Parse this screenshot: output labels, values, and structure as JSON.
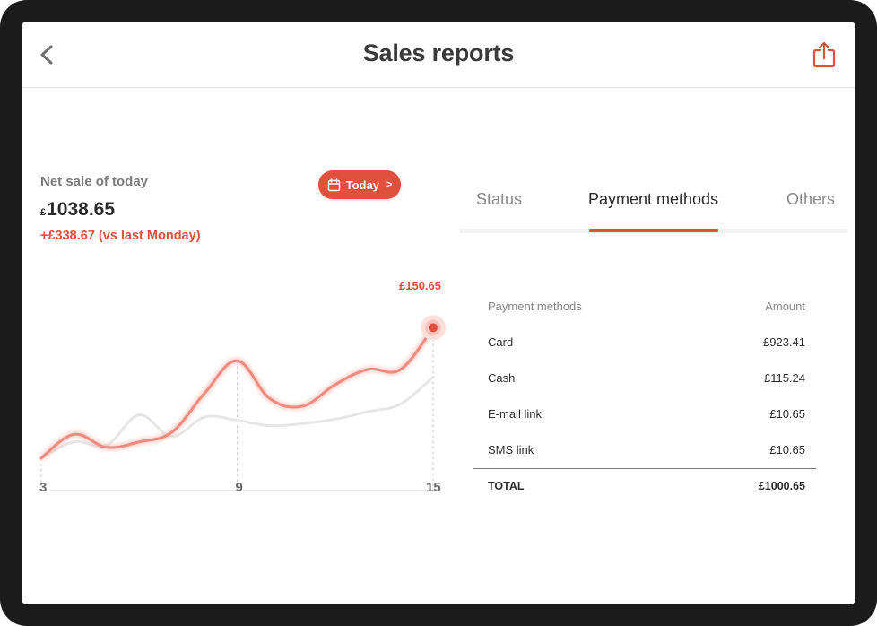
{
  "header": {
    "title": "Sales reports"
  },
  "summary": {
    "net_label": "Net sale of today",
    "currency": "£",
    "net_value": "1038.65",
    "change": "+£338.67 (vs last Monday)",
    "period_button": "Today",
    "period_chevron": ">"
  },
  "chart_data": {
    "type": "line",
    "x": [
      3,
      4,
      5,
      6,
      7,
      8,
      9,
      10,
      11,
      12,
      13,
      14,
      15
    ],
    "xticks": [
      "3",
      "9",
      "15"
    ],
    "series": [
      {
        "values": [
          30,
          52,
          40,
          45,
          54,
          90,
          120,
          85,
          78,
          98,
          112,
          112,
          150.65
        ]
      },
      {
        "values": [
          30,
          45,
          42,
          70,
          50,
          68,
          65,
          60,
          62,
          66,
          73,
          80,
          105
        ]
      }
    ],
    "peak_label": "£150.65",
    "colors": {
      "accent": "#e1503f",
      "comparison": "#e6e6e6"
    },
    "gridlines_at_x": [
      9,
      15
    ],
    "ylim": [
      0,
      170
    ]
  },
  "tabs": [
    {
      "label": "Status",
      "active": false
    },
    {
      "label": "Payment methods",
      "active": true
    },
    {
      "label": "Others",
      "active": false
    }
  ],
  "table": {
    "headers": [
      "Payment methods",
      "Amount"
    ],
    "rows": [
      [
        "Card",
        "£923.41"
      ],
      [
        "Cash",
        "£115.24"
      ],
      [
        "E-mail link",
        "£10.65"
      ],
      [
        "SMS link",
        "£10.65"
      ]
    ],
    "total": [
      "TOTAL",
      "£1000.65"
    ]
  },
  "colors": {
    "accent": "#e1503f",
    "text_primary": "#2a2a2a",
    "text_muted": "#8a8a8a"
  },
  "icons": {
    "back": "chevron-left-icon",
    "share": "share-icon",
    "calendar": "calendar-icon"
  }
}
